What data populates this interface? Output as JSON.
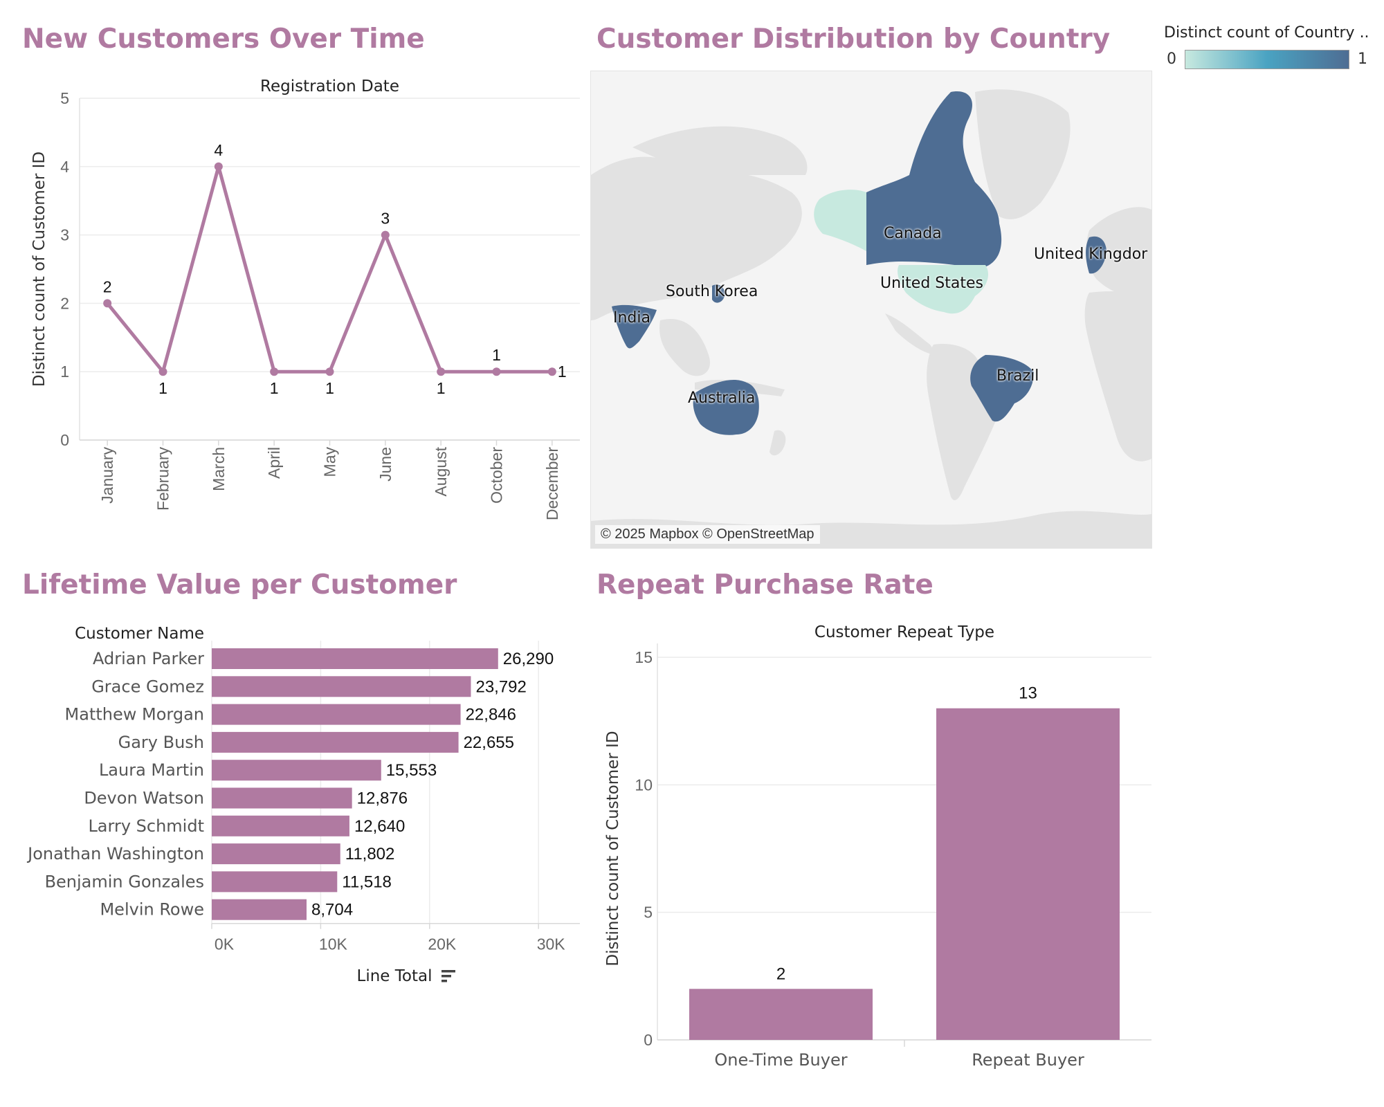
{
  "titles": {
    "customers_over_time": "New Customers Over Time",
    "distribution": "Customer Distribution by Country",
    "lifetime_value": "Lifetime Value per Customer",
    "repeat_rate": "Repeat Purchase Rate"
  },
  "map": {
    "attribution": "© 2025 Mapbox © OpenStreetMap",
    "legend": {
      "title": "Distinct count of Country ..",
      "min": "0",
      "max": "1",
      "color_min": "#c7e9df",
      "color_max": "#4e6d93"
    },
    "countries": [
      {
        "name": "Canada",
        "value": 1
      },
      {
        "name": "United States",
        "value": 0
      },
      {
        "name": "United Kingdor",
        "value": 1
      },
      {
        "name": "South Korea",
        "value": 1
      },
      {
        "name": "India",
        "value": 1
      },
      {
        "name": "Australia",
        "value": 1
      },
      {
        "name": "Brazil",
        "value": 1
      }
    ],
    "colors": {
      "land": "#e2e2e2",
      "water": "#f4f4f4",
      "high": "#4e6d93",
      "low": "#c7e9df"
    }
  },
  "chart_data": [
    {
      "type": "line",
      "title": "Registration Date",
      "xlabel": "",
      "ylabel": "Distinct count of Customer ID",
      "categories": [
        "January",
        "February",
        "March",
        "April",
        "May",
        "June",
        "August",
        "October",
        "December"
      ],
      "values": [
        2,
        1,
        4,
        1,
        1,
        3,
        1,
        1,
        1
      ],
      "ylim": [
        0,
        5
      ],
      "yticks": [
        "0",
        "1",
        "2",
        "3",
        "4",
        "5"
      ],
      "data_labels": [
        "2",
        "1",
        "4",
        "1",
        "1",
        "3",
        "1",
        "1",
        "1"
      ],
      "color": "#b07aa1",
      "grid": true
    },
    {
      "type": "bar",
      "orientation": "horizontal",
      "category_header": "Customer Name",
      "categories": [
        "Adrian Parker",
        "Grace Gomez",
        "Matthew Morgan",
        "Gary Bush",
        "Laura Martin",
        "Devon Watson",
        "Larry Schmidt",
        "Jonathan Washington",
        "Benjamin Gonzales",
        "Melvin Rowe"
      ],
      "values": [
        26290,
        23792,
        22846,
        22655,
        15553,
        12876,
        12640,
        11802,
        11518,
        8704
      ],
      "data_labels": [
        "26,290",
        "23,792",
        "22,846",
        "22,655",
        "15,553",
        "12,876",
        "12,640",
        "11,802",
        "11,518",
        "8,704"
      ],
      "xlabel": "Line Total",
      "xlim": [
        0,
        33800
      ],
      "xticks": [
        {
          "value": 0,
          "label": "0K"
        },
        {
          "value": 10000,
          "label": "10K"
        },
        {
          "value": 20000,
          "label": "20K"
        },
        {
          "value": 30000,
          "label": "30K"
        }
      ],
      "color": "#b07aa1",
      "grid": true
    },
    {
      "type": "bar",
      "title": "Customer Repeat Type",
      "ylabel": "Distinct count of Customer ID",
      "categories": [
        "One-Time Buyer",
        "Repeat Buyer"
      ],
      "values": [
        2,
        13
      ],
      "data_labels": [
        "2",
        "13"
      ],
      "ylim": [
        0,
        15
      ],
      "yticks": [
        "0",
        "5",
        "10",
        "15"
      ],
      "color": "#b07aa1",
      "grid": true
    }
  ]
}
